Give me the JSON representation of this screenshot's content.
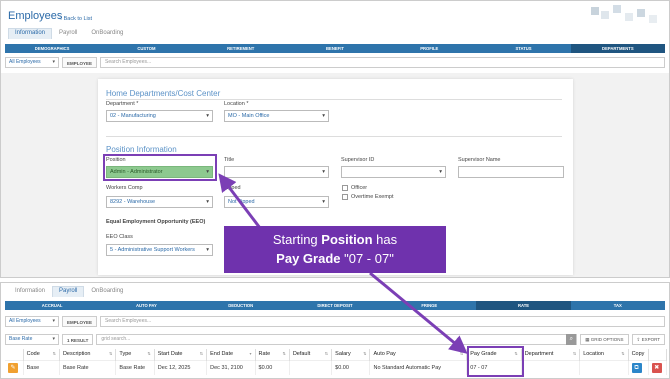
{
  "header": {
    "title": "Employees",
    "back_link": "« Back to List"
  },
  "top_tabs": [
    "Information",
    "Payroll",
    "OnBoarding"
  ],
  "top_nav": [
    "DEMOGRAPHICS",
    "CUSTOM",
    "RETIREMENT",
    "BENEFIT",
    "PROFILE",
    "STATUS",
    "DEPARTMENTS"
  ],
  "top_filter": {
    "employees": "All Employees",
    "employee_label": "EMPLOYEE",
    "search_placeholder": "Search Employees..."
  },
  "home_section": {
    "title": "Home Departments/Cost Center",
    "department_label": "Department *",
    "department_value": "02 - Manufacturing",
    "location_label": "Location *",
    "location_value": "MO - Main Office"
  },
  "position_section": {
    "title": "Position Information",
    "position_label": "Position",
    "position_value": "Admin - Administrator",
    "title_label": "Title",
    "supervisor_id_label": "Supervisor ID",
    "supervisor_name_label": "Supervisor Name",
    "workers_comp_label": "Workers Comp",
    "workers_comp_value": "8292 - Warehouse",
    "tipped_label": "Tipped",
    "tipped_value": "Not Tipped",
    "officer_label": "Officer",
    "overtime_label": "Overtime Exempt",
    "eeo_heading": "Equal Employment Opportunity (EEO)",
    "eeo_label": "EEO Class",
    "eeo_value": "5 - Administrative Support Workers"
  },
  "callout": {
    "line1_prefix": "Starting ",
    "line1_bold": "Position",
    "line1_suffix": " has",
    "line2_bold": "Pay Grade",
    "line2_suffix": " \"07 - 07\""
  },
  "bottom_tabs": [
    "Information",
    "Payroll",
    "OnBoarding"
  ],
  "bottom_nav": [
    "ACCRUAL",
    "AUTO PAY",
    "DEDUCTION",
    "DIRECT DEPOSIT",
    "FRINGE",
    "RATE",
    "TAX"
  ],
  "bottom_filter": {
    "employees": "All Employees",
    "employee_label": "EMPLOYEE",
    "search_placeholder": "Search Employees..."
  },
  "grid_toolbar": {
    "rate_select": "Base Rate",
    "result": "1 RESULT",
    "grid_search": "grid search...",
    "grid_options": "GRID OPTIONS",
    "export": "EXPORT"
  },
  "table": {
    "headers": [
      "Code",
      "Description",
      "Type",
      "Start Date",
      "End Date",
      "Rate",
      "Default",
      "Salary",
      "Auto Pay",
      "Pay Grade",
      "Department",
      "Location",
      "Copy"
    ],
    "row": [
      "Base",
      "Base Rate",
      "Base Rate",
      "Dec 12, 2025",
      "Dec 31, 2100",
      "$0.00",
      "",
      "$0.00",
      "No Standard Automatic Pay",
      "07 - 07",
      "",
      ""
    ]
  },
  "colors": {
    "accent": "#2e74ab",
    "callout": "#6f32ad",
    "highlight": "#7b3fb5",
    "position_fill": "#8dc98f"
  }
}
